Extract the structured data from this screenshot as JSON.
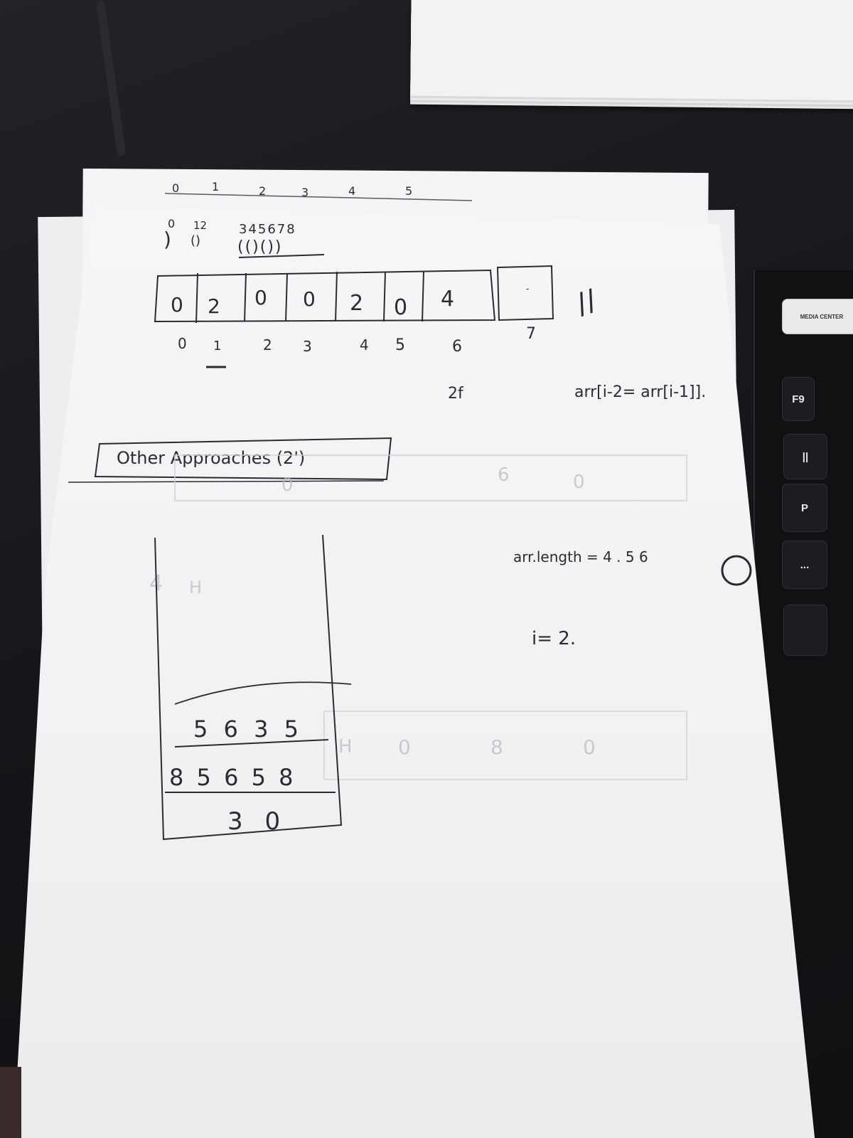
{
  "scene": {
    "ruler_top": [
      "0",
      "1",
      "2",
      "3",
      "4",
      "5"
    ],
    "brackets": {
      "left_digits": "0",
      "small": "12",
      "parens": "()",
      "digits": "345678",
      "pattern": "(()())"
    },
    "array": {
      "values": [
        "0",
        "2",
        "0",
        "0",
        "2",
        "0",
        "4"
      ],
      "indices": [
        "0",
        "1",
        "2",
        "3",
        "4",
        "5",
        "6"
      ],
      "extra_index": "7",
      "extra_cell": "-"
    },
    "notes": {
      "double_slash": "//",
      "two_f": "2f",
      "formula": "arr[i-2= arr[i-1]].",
      "box_label": "Other Approaches (2')",
      "arr_length": "arr.length = 4 . 5 6",
      "i_equals": "i= 2."
    },
    "stack_box": {
      "row1": "5 6 3 5",
      "row2": "8 5 6 5 8",
      "row3": "3 0"
    },
    "keyboard": {
      "keys": [
        "F9",
        "P",
        "||",
        "..."
      ],
      "media_key": "MEDIA CENTER"
    }
  }
}
